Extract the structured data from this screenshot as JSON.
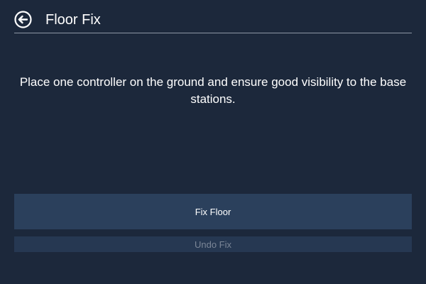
{
  "header": {
    "title": "Floor Fix",
    "back_icon": "back-arrow-circle-icon"
  },
  "main": {
    "instruction": "Place one controller on the ground and ensure good visibility to the base stations."
  },
  "actions": {
    "fix_label": "Fix Floor",
    "undo_label": "Undo Fix",
    "undo_enabled": false
  },
  "colors": {
    "background": "#1c283b",
    "button": "#2b405c",
    "button_disabled": "#263852",
    "text": "#ffffff",
    "text_disabled": "#7b8697"
  }
}
